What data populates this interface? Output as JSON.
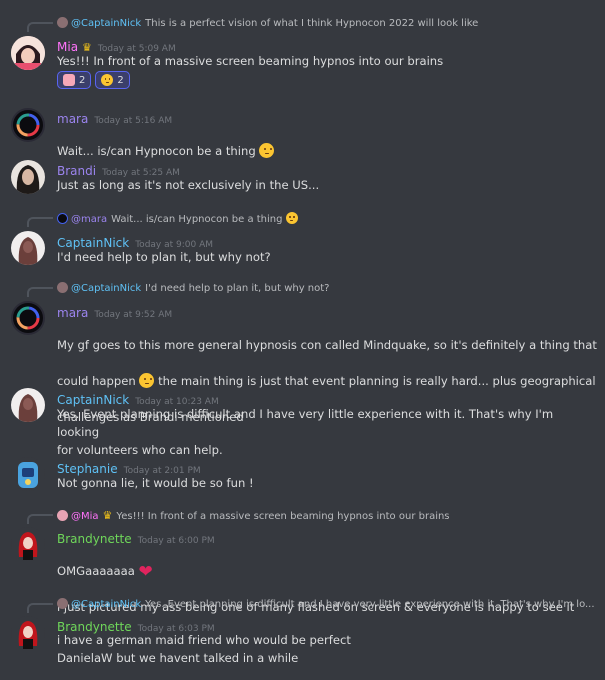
{
  "colors": {
    "background": "#36393f",
    "mia": "#ff73fa",
    "mara": "#9b84ee",
    "brandi": "#9b84ee",
    "captainnick": "#5fc1f5",
    "stephanie": "#5fc1f5",
    "brandynette": "#6fd65a"
  },
  "messages": [
    {
      "reply_to": "@CaptainNick",
      "reply_text": "This is a perfect vision of what I think Hypnocon 2022 will look like",
      "author": "Mia",
      "timestamp": "Today at 5:09 AM",
      "text": "Yes!!! In front of a massive screen beaming hypnos into our brains",
      "reactions": [
        {
          "emoji": "smiling-face-icon",
          "count": "2"
        },
        {
          "emoji": "heart-eyes-icon",
          "count": "2"
        }
      ]
    },
    {
      "author": "mara",
      "timestamp": "Today at 5:16 AM",
      "text": "Wait... is/can Hypnocon be a thing"
    },
    {
      "author": "Brandi",
      "timestamp": "Today at 5:25 AM",
      "text": "Just as long as it's not exclusively in the US..."
    },
    {
      "reply_to": "@mara",
      "reply_text": "Wait... is/can Hypnocon be a thing",
      "author": "CaptainNick",
      "timestamp": "Today at 9:00 AM",
      "text": "I'd need help to plan it, but why not?"
    },
    {
      "reply_to": "@CaptainNick",
      "reply_text": "I'd need help to plan it, but why not?",
      "author": "mara",
      "timestamp": "Today at 9:52 AM",
      "text_a": "My gf goes to this more general hypnosis con called Mindquake, so it's definitely a thing that",
      "text_b1": "could happen",
      "text_b2": "the main thing is just that event planning is really hard... plus geographical",
      "text_c": "challenges as Brandi mentioned"
    },
    {
      "author": "CaptainNick",
      "timestamp": "Today at 10:23 AM",
      "text": "Yes. Event planning is difficult and I have very little experience with it. That's why I'm looking\nfor volunteers who can help."
    },
    {
      "author": "Stephanie",
      "timestamp": "Today at 2:01 PM",
      "text": "Not gonna lie, it would be so fun !"
    },
    {
      "reply_to": "@Mia",
      "reply_text": "Yes!!! In front of a massive screen beaming hypnos into our brains",
      "author": "Brandynette",
      "timestamp": "Today at 6:00 PM",
      "text_a": "OMGaaaaaaa",
      "text_b": "i just pictured my ass being one of many flashed on screen & everyone is happy to see it"
    },
    {
      "reply_to": "@CaptainNick",
      "reply_text": "Yes. Event planning is difficult and I have very little experience with it. That's why I'm lo...",
      "author": "Brandynette",
      "timestamp": "Today at 6:03 PM",
      "text": "i have a german maid friend who would be perfect\nDanielaW but we havent talked in a while"
    }
  ]
}
